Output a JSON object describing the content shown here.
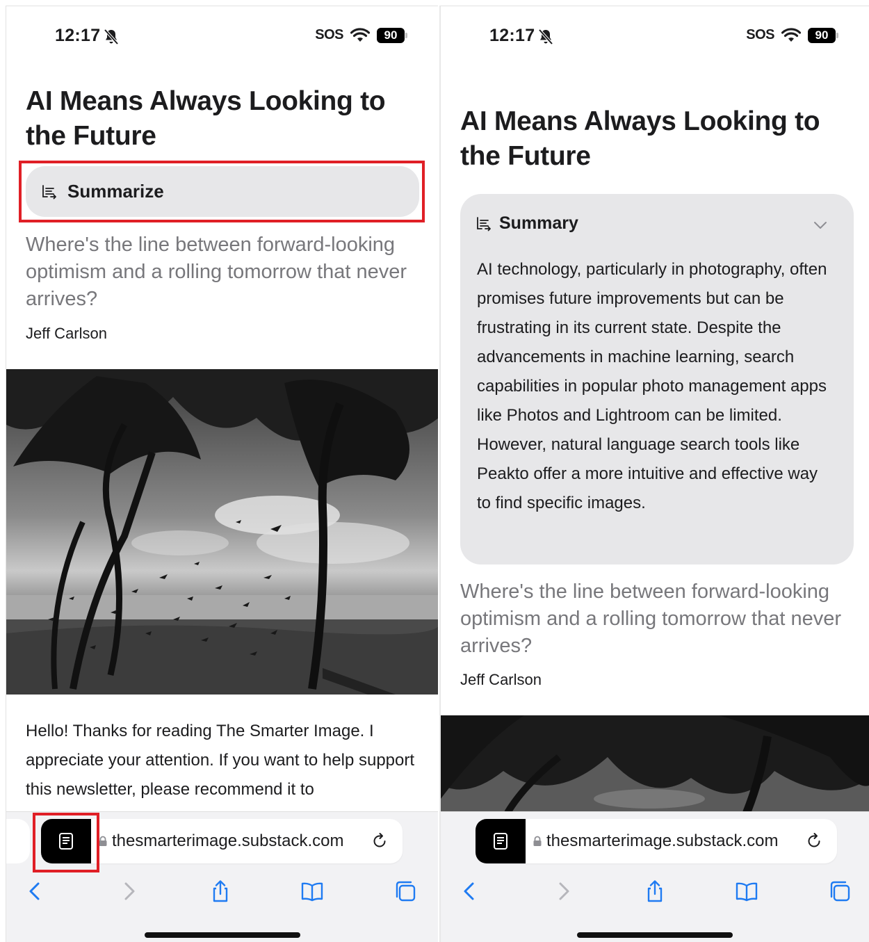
{
  "status": {
    "time": "12:17",
    "sos": "SOS",
    "battery": "90"
  },
  "article": {
    "title": "AI Means Always Looking to the Future",
    "subtitle": "Where's the line between forward-looking optimism and a rolling tomorrow that never arrives?",
    "author": "Jeff Carlson",
    "body": "Hello! Thanks for reading The Smarter Image. I appreciate your attention. If you want to help support this newsletter, please recommend it to"
  },
  "summarize": {
    "label": "Summarize"
  },
  "summary": {
    "title": "Summary",
    "text": "AI technology, particularly in photography, often promises future improvements but can be frustrating in its current state. Despite the advancements in machine learning, search capabilities in popular photo management apps like Photos and Lightroom can be limited. However, natural language search tools like Peakto offer a more intuitive and effective way to find specific images."
  },
  "browser": {
    "url": "thesmarterimage.substack.com"
  },
  "icons": {
    "bell": "bell-slash-icon",
    "wifi": "wifi-icon",
    "summarize": "summarize-icon",
    "chevron": "chevron-down-icon",
    "reader": "reader-mode-icon",
    "lock": "lock-icon",
    "reload": "reload-icon",
    "back": "back-arrow-icon",
    "forward": "forward-arrow-icon",
    "share": "share-icon",
    "bookmarks": "bookmarks-icon",
    "tabs": "tabs-icon"
  },
  "colors": {
    "highlight": "#e01f26",
    "card": "#e7e7e9",
    "subtitle": "#77777b"
  }
}
